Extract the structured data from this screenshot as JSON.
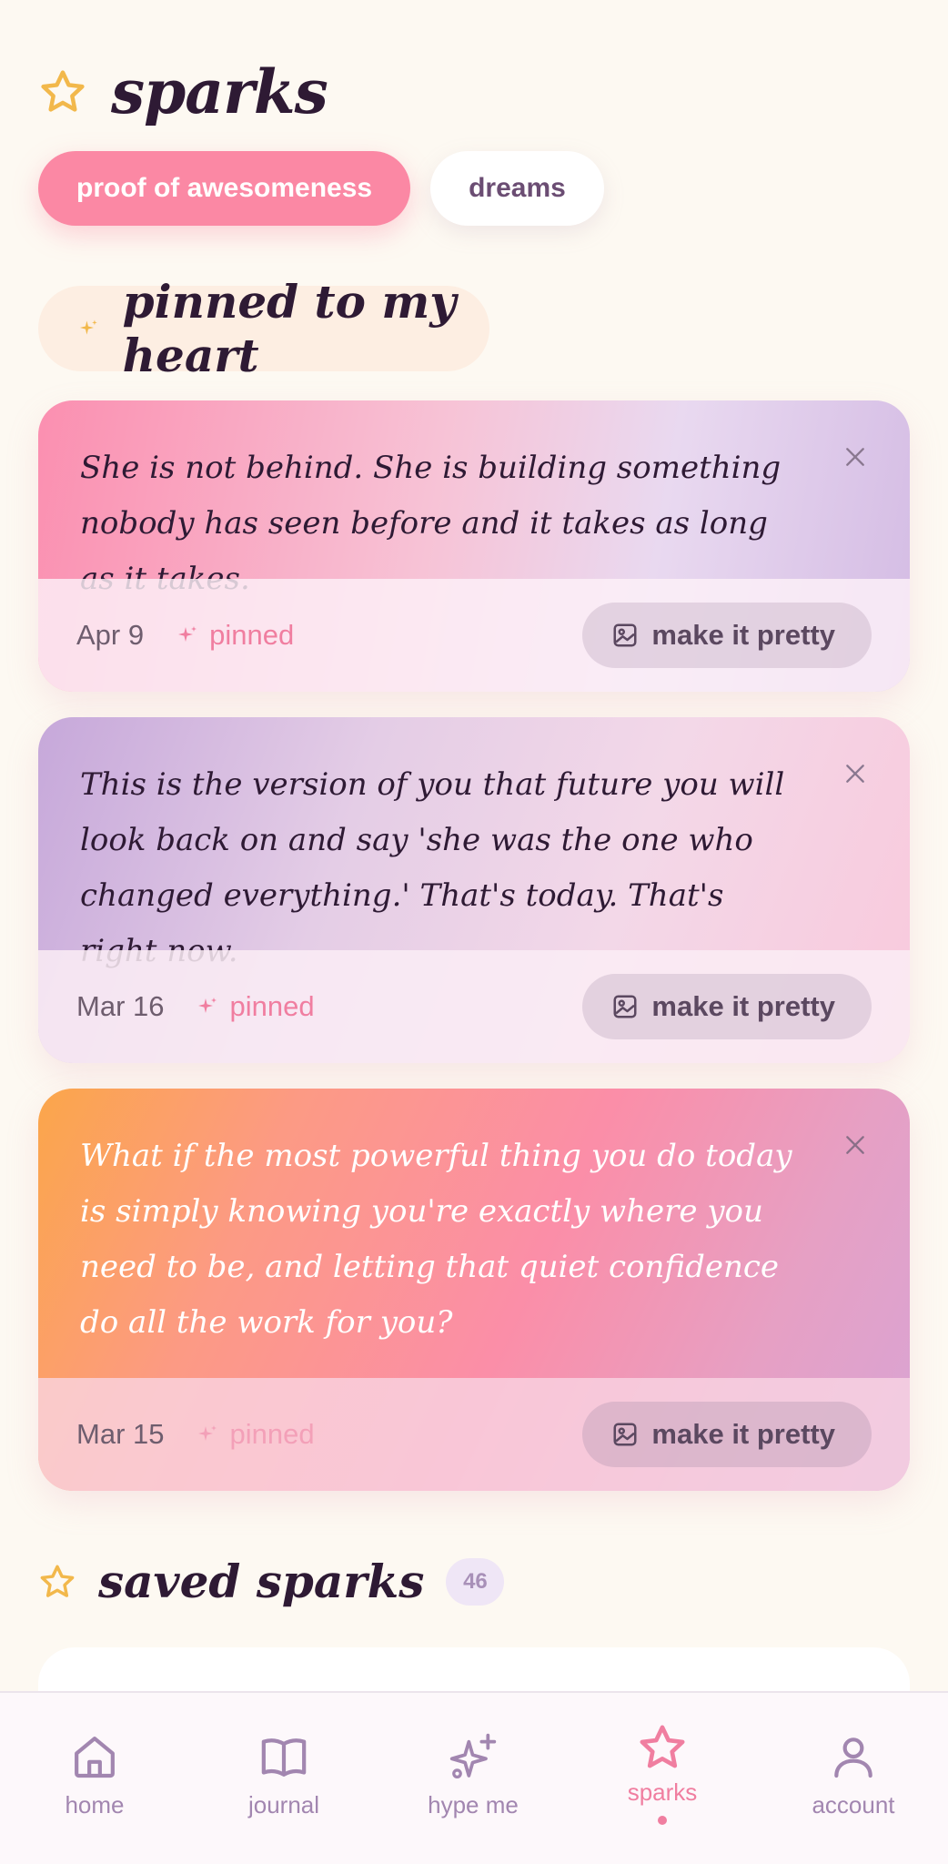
{
  "header": {
    "title": "sparks",
    "icon": "star-icon"
  },
  "chips": [
    {
      "label": "proof of awesomeness",
      "active": true
    },
    {
      "label": "dreams",
      "active": false
    }
  ],
  "pinned_section": {
    "title": "pinned to my heart",
    "icon": "sparkle-icon"
  },
  "pinned_cards": [
    {
      "quote": "She is not behind. She is building something nobody has seen before and it takes as long as it takes.",
      "date": "Apr 9",
      "pinned_label": "pinned",
      "action_label": "make it pretty"
    },
    {
      "quote": "This is the version of you that future you will look back on and say 'she was the one who changed everything.' That's today. That's right now.",
      "date": "Mar 16",
      "pinned_label": "pinned",
      "action_label": "make it pretty"
    },
    {
      "quote": "What if the most powerful thing you do today is simply knowing you're exactly where you need to be, and letting that quiet confidence do all the work for you?",
      "date": "Mar 15",
      "pinned_label": "pinned",
      "action_label": "make it pretty"
    }
  ],
  "saved_section": {
    "title": "saved sparks",
    "count": "46"
  },
  "nav": {
    "items": [
      {
        "label": "home",
        "icon": "home-icon"
      },
      {
        "label": "journal",
        "icon": "book-icon"
      },
      {
        "label": "hype me",
        "icon": "sparkle-plus-icon"
      },
      {
        "label": "sparks",
        "icon": "star-icon",
        "active": true
      },
      {
        "label": "account",
        "icon": "user-icon"
      }
    ]
  },
  "colors": {
    "background": "#fdf9f2",
    "accent_pink": "#fb88a4",
    "star_gold": "#f2b84b",
    "nav_purple": "#a286b0"
  }
}
